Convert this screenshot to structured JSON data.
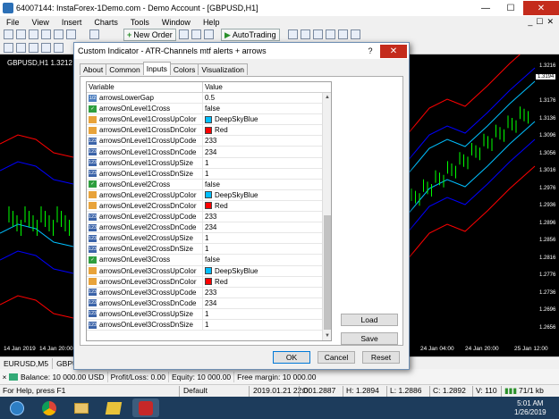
{
  "window": {
    "title": "64007144: InstaForex-1Demo.com - Demo Account - [GBPUSD,H1]",
    "minimize": "—",
    "maximize": "☐",
    "close": "✕"
  },
  "menu": [
    "File",
    "View",
    "Insert",
    "Charts",
    "Tools",
    "Window",
    "Help"
  ],
  "menu_right": [
    "_",
    "☐",
    "✕"
  ],
  "toolbar": {
    "new_order": "New Order",
    "autotrading": "AutoTrading"
  },
  "chart": {
    "label": "GBPUSD,H1  1.3212 1.32",
    "prices": [
      "1.3216",
      "1.3194",
      "1.3176",
      "1.3136",
      "1.3096",
      "1.3056",
      "1.3016",
      "1.2976",
      "1.2936",
      "1.2896",
      "1.2856",
      "1.2816",
      "1.2776",
      "1.2736",
      "1.2696",
      "1.2656"
    ],
    "current_price": "1.3194",
    "times": [
      "14 Jan 2019",
      "14 Jan 20:00",
      "24 Jan 04:00",
      "24 Jan 20:00",
      "25 Jan 12:00"
    ]
  },
  "chart_tabs": [
    "EURUSD,M5",
    "GBPU"
  ],
  "terminal": {
    "balance": "Balance: 10 000.00  USD",
    "profit": "Profit/Loss: 0.00",
    "equity": "Equity: 10 000.00",
    "free_margin": "Free margin: 10 000.00"
  },
  "status": {
    "help": "For Help, press F1",
    "profile": "Default",
    "datetime": "2019.01.21 22:00",
    "open": "O: 1.2887",
    "high": "H: 1.2894",
    "low": "L: 1.2886",
    "close": "C: 1.2892",
    "volume": "V: 110",
    "traffic": "71/1 kb"
  },
  "clock": {
    "time": "5:01 AM",
    "date": "1/26/2019"
  },
  "dialog": {
    "title": "Custom Indicator - ATR-Channels mtf alerts + arrows",
    "help": "?",
    "close": "✕",
    "tabs": [
      "About",
      "Common",
      "Inputs",
      "Colors",
      "Visualization"
    ],
    "active_tab": "Inputs",
    "columns": [
      "Variable",
      "Value"
    ],
    "rows": [
      {
        "type": "val",
        "name": "arrowsLowerGap",
        "value": "0.5"
      },
      {
        "type": "bool",
        "name": "arrowsOnLevel1Cross",
        "value": "false"
      },
      {
        "type": "col",
        "name": "arrowsOnLevel1CrossUpColor",
        "value": "DeepSkyBlue",
        "color": "#00bfff"
      },
      {
        "type": "col",
        "name": "arrowsOnLevel1CrossDnColor",
        "value": "Red",
        "color": "#ff0000"
      },
      {
        "type": "int",
        "name": "arrowsOnLevel1CrossUpCode",
        "value": "233"
      },
      {
        "type": "int",
        "name": "arrowsOnLevel1CrossDnCode",
        "value": "234"
      },
      {
        "type": "int",
        "name": "arrowsOnLevel1CrossUpSize",
        "value": "1"
      },
      {
        "type": "int",
        "name": "arrowsOnLevel1CrossDnSize",
        "value": "1"
      },
      {
        "type": "bool",
        "name": "arrowsOnLevel2Cross",
        "value": "false"
      },
      {
        "type": "col",
        "name": "arrowsOnLevel2CrossUpColor",
        "value": "DeepSkyBlue",
        "color": "#00bfff"
      },
      {
        "type": "col",
        "name": "arrowsOnLevel2CrossDnColor",
        "value": "Red",
        "color": "#ff0000"
      },
      {
        "type": "int",
        "name": "arrowsOnLevel2CrossUpCode",
        "value": "233"
      },
      {
        "type": "int",
        "name": "arrowsOnLevel2CrossDnCode",
        "value": "234"
      },
      {
        "type": "int",
        "name": "arrowsOnLevel2CrossUpSize",
        "value": "1"
      },
      {
        "type": "int",
        "name": "arrowsOnLevel2CrossDnSize",
        "value": "1"
      },
      {
        "type": "bool",
        "name": "arrowsOnLevel3Cross",
        "value": "false"
      },
      {
        "type": "col",
        "name": "arrowsOnLevel3CrossUpColor",
        "value": "DeepSkyBlue",
        "color": "#00bfff"
      },
      {
        "type": "col",
        "name": "arrowsOnLevel3CrossDnColor",
        "value": "Red",
        "color": "#ff0000"
      },
      {
        "type": "int",
        "name": "arrowsOnLevel3CrossUpCode",
        "value": "233"
      },
      {
        "type": "int",
        "name": "arrowsOnLevel3CrossDnCode",
        "value": "234"
      },
      {
        "type": "int",
        "name": "arrowsOnLevel3CrossUpSize",
        "value": "1"
      },
      {
        "type": "int",
        "name": "arrowsOnLevel3CrossDnSize",
        "value": "1"
      }
    ],
    "load": "Load",
    "save": "Save",
    "ok": "OK",
    "cancel": "Cancel",
    "reset": "Reset"
  },
  "colors": {
    "accent": "#0078d7",
    "band_outer": "#ff0000",
    "band_mid": "#0000ff",
    "band_inner": "#00bfff",
    "candle": "#00ff00"
  }
}
